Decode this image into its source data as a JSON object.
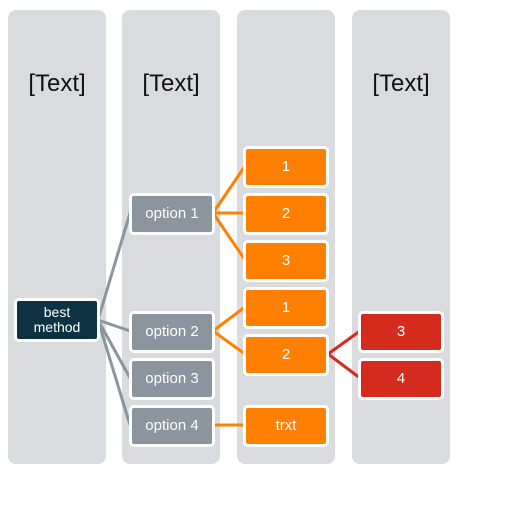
{
  "columns": [
    {
      "title": "[Text]"
    },
    {
      "title": "[Text]"
    },
    {
      "title": ""
    },
    {
      "title": "[Text]"
    }
  ],
  "colors": {
    "column_bg": "#d9dbde",
    "root": "#0d3242",
    "option": "#8a959d",
    "orange": "#ff8000",
    "red": "#d52b1e",
    "grey_link": "#8a959d"
  },
  "root": {
    "label": "best method"
  },
  "options": [
    {
      "label": "option 1"
    },
    {
      "label": "option 2"
    },
    {
      "label": "option 3"
    },
    {
      "label": "option 4"
    }
  ],
  "level3": [
    {
      "label": "1",
      "parent": "option 1"
    },
    {
      "label": "2",
      "parent": "option 1"
    },
    {
      "label": "3",
      "parent": "option 1"
    },
    {
      "label": "1",
      "parent": "option 2"
    },
    {
      "label": "2",
      "parent": "option 2"
    },
    {
      "label": "trxt",
      "parent": "option 4"
    }
  ],
  "level4": [
    {
      "label": "3",
      "parent": "2 (option 2)"
    },
    {
      "label": "4",
      "parent": "2 (option 2)"
    }
  ]
}
